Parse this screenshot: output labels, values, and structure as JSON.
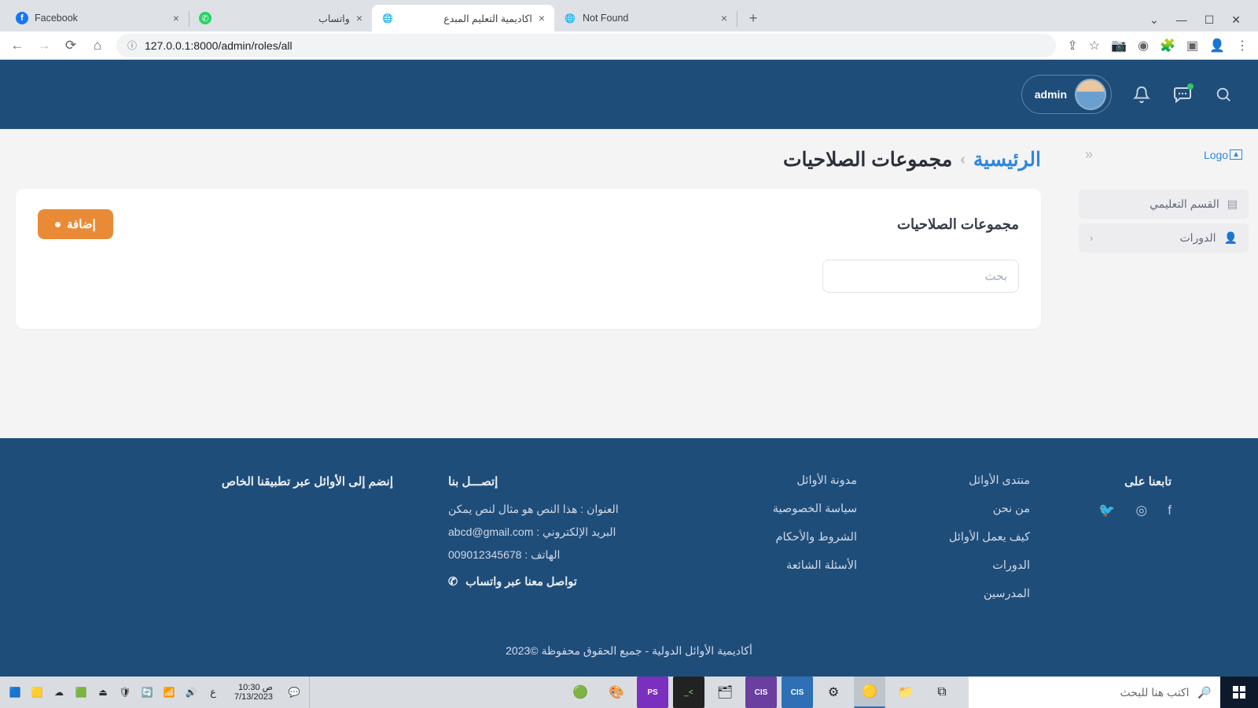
{
  "browser": {
    "tabs": [
      {
        "title": "Facebook",
        "fav": "fb"
      },
      {
        "title": "واتساب",
        "fav": "wa"
      },
      {
        "title": "اكاديمية التعليم المبدع",
        "fav": "globe",
        "active": true
      },
      {
        "title": "Not Found",
        "fav": "globe"
      }
    ],
    "url": "127.0.0.1:8000/admin/roles/all"
  },
  "header": {
    "user": "admin"
  },
  "sidebar": {
    "logo": "Logo",
    "items": [
      {
        "label": "القسم التعليمي",
        "icon": "tiles",
        "chev": false
      },
      {
        "label": "الدورات",
        "icon": "user",
        "chev": true
      }
    ]
  },
  "breadcrumb": {
    "home": "الرئيسية",
    "current": "مجموعات الصلاحيات"
  },
  "card": {
    "title": "مجموعات الصلاحيات",
    "add": "إضافة",
    "search_ph": "بحث"
  },
  "footer": {
    "follow": "تابعنا على",
    "col1": [
      "منتدى الأوائل",
      "من نحن",
      "كيف يعمل الأوائل",
      "الدورات",
      "المدرسين"
    ],
    "col2": [
      "مدونة الأوائل",
      "سياسة الخصوصية",
      "الشروط والأحكام",
      "الأسئلة الشائعة"
    ],
    "contact_title": "إتصـــل بنا",
    "addr": "العنوان : هذا النص هو مثال لنص يمكن",
    "email": "البريد الإلكتروني : abcd@gmail.com",
    "phone": "الهاتف : 009012345678",
    "whatsapp": "تواصل معنا عبر واتساب",
    "join": "إنضم إلى الأوائل عبر تطبيقنا الخاص",
    "copy": "أكاديمية الأوائل الدولية - جميع الحقوق محفوظة ©2023"
  },
  "taskbar": {
    "search_ph": "اكتب هنا للبحث",
    "time": "10:30 ص",
    "date": "7/13/2023",
    "lang": "ع"
  }
}
